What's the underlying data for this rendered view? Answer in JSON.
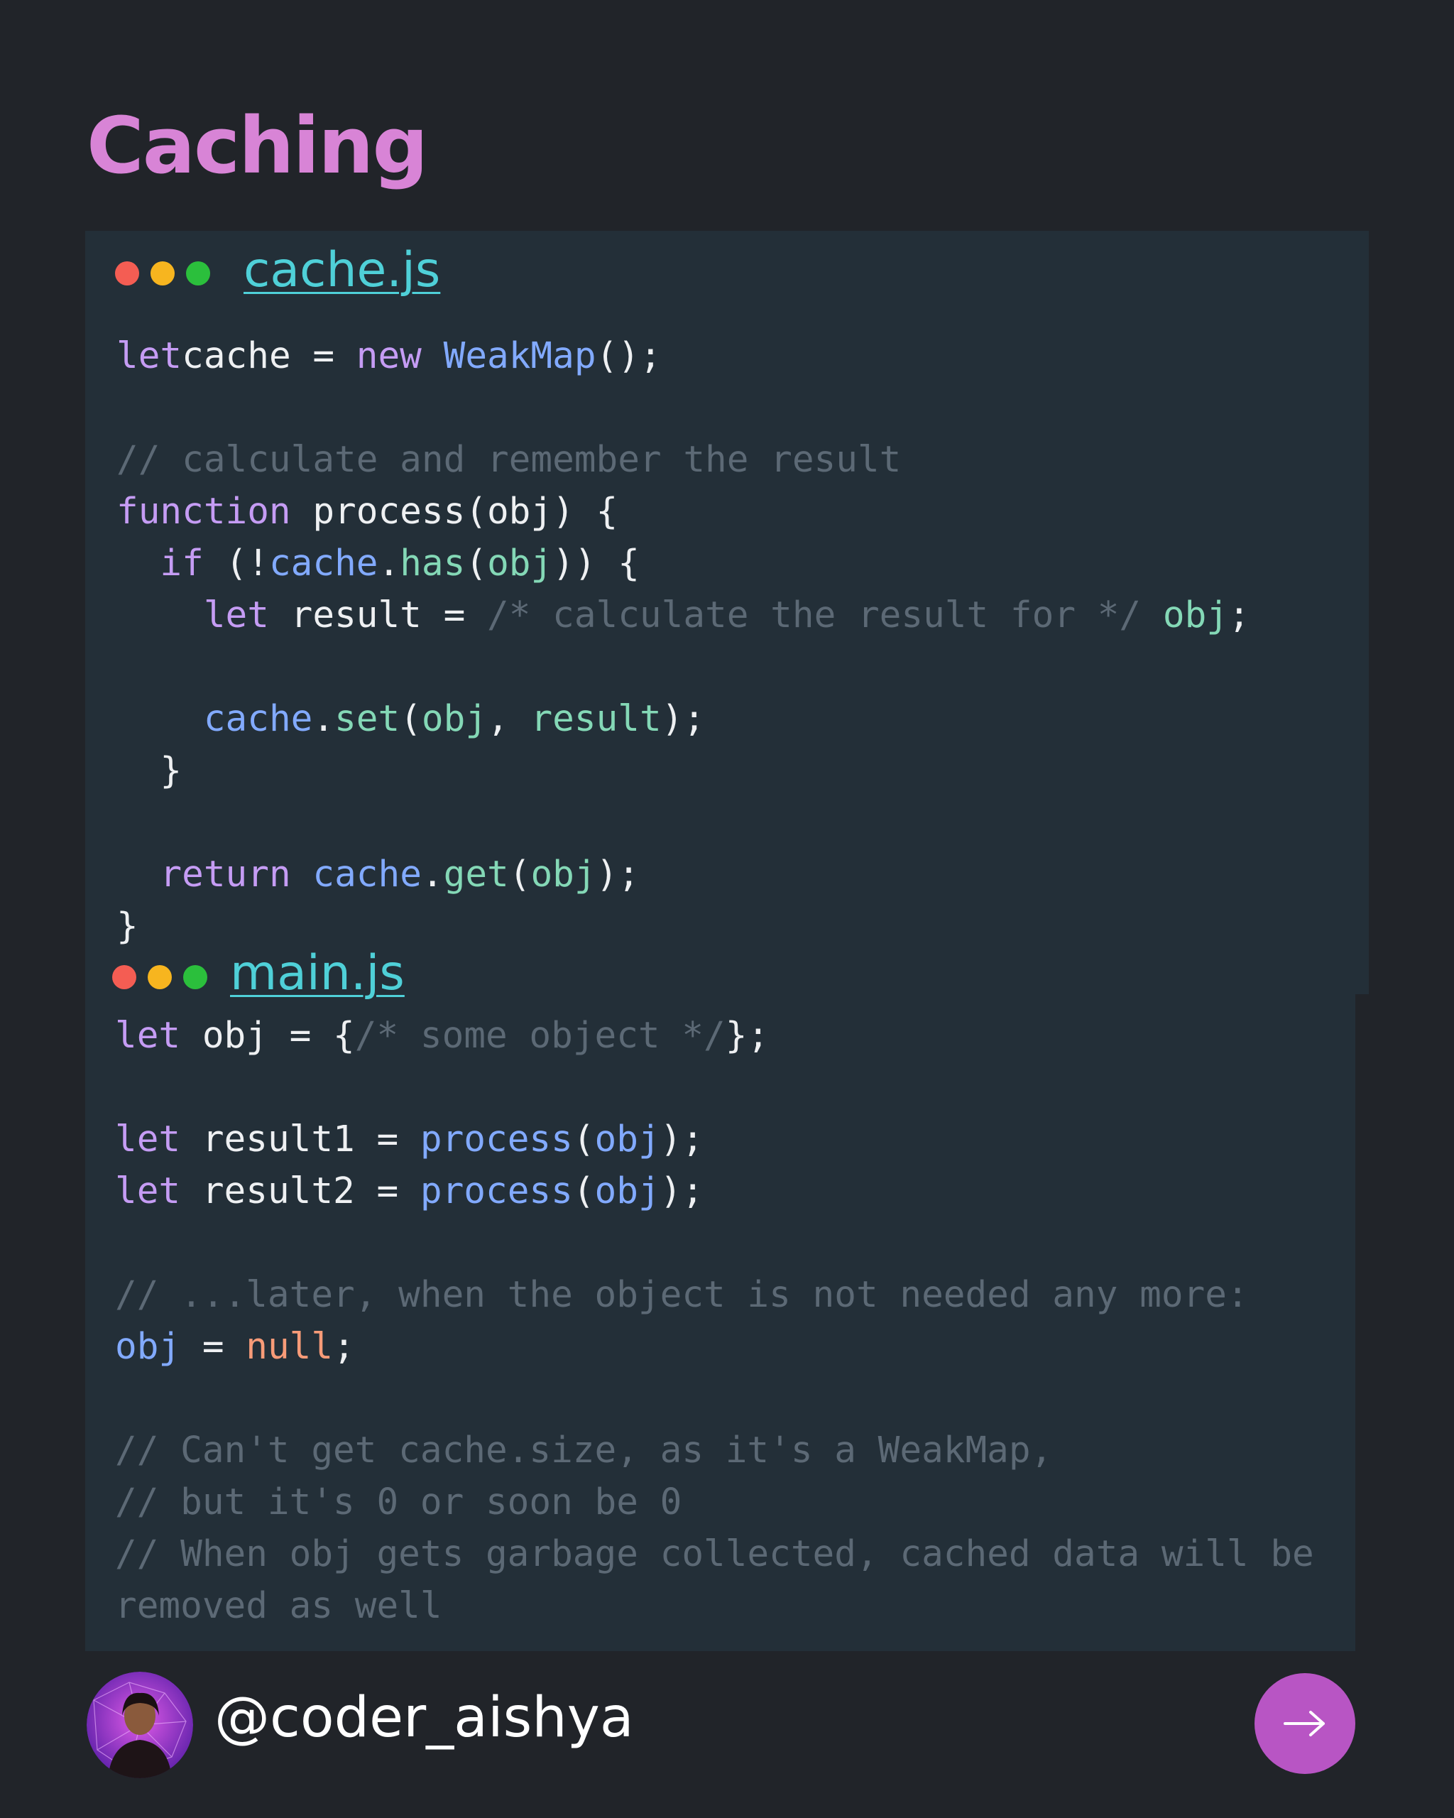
{
  "title": "Caching",
  "colors": {
    "background": "#212429",
    "title": "#d884d6",
    "panel": "#232f38",
    "filename": "#4fd0d8",
    "button": "#b855c4"
  },
  "file1": {
    "name": "cache.js",
    "lines": [
      [
        [
          "kw",
          "let"
        ],
        [
          "",
          "cache = "
        ],
        [
          "kw",
          "new"
        ],
        [
          "",
          " "
        ],
        [
          "fn",
          "WeakMap"
        ],
        [
          "",
          "();"
        ]
      ],
      [],
      [
        [
          "cm",
          "// calculate and remember the result"
        ]
      ],
      [
        [
          "kw",
          "function"
        ],
        [
          "",
          " process(obj) {"
        ]
      ],
      [
        [
          "",
          "  "
        ],
        [
          "kw",
          "if"
        ],
        [
          "",
          " (!"
        ],
        [
          "var",
          "cache"
        ],
        [
          "",
          "."
        ],
        [
          "prop",
          "has"
        ],
        [
          "",
          "("
        ],
        [
          "prop",
          "obj"
        ],
        [
          "",
          ")) {"
        ]
      ],
      [
        [
          "",
          "    "
        ],
        [
          "kw",
          "let"
        ],
        [
          "",
          " result = "
        ],
        [
          "cm",
          "/* calculate the result for */"
        ],
        [
          "",
          " "
        ],
        [
          "prop",
          "obj"
        ],
        [
          "",
          ";"
        ]
      ],
      [],
      [
        [
          "",
          "    "
        ],
        [
          "var",
          "cache"
        ],
        [
          "",
          "."
        ],
        [
          "prop",
          "set"
        ],
        [
          "",
          "("
        ],
        [
          "prop",
          "obj"
        ],
        [
          "",
          ", "
        ],
        [
          "prop",
          "result"
        ],
        [
          "",
          ");"
        ]
      ],
      [
        [
          "",
          "  }"
        ]
      ],
      [],
      [
        [
          "",
          "  "
        ],
        [
          "kw",
          "return"
        ],
        [
          "",
          " "
        ],
        [
          "var",
          "cache"
        ],
        [
          "",
          "."
        ],
        [
          "prop",
          "get"
        ],
        [
          "",
          "("
        ],
        [
          "prop",
          "obj"
        ],
        [
          "",
          ");"
        ]
      ],
      [
        [
          "",
          "}"
        ]
      ]
    ]
  },
  "file2": {
    "name": "main.js",
    "lines": [
      [
        [
          "kw",
          "let"
        ],
        [
          "",
          " obj = {"
        ],
        [
          "cm",
          "/* some object */"
        ],
        [
          "",
          "};"
        ]
      ],
      [],
      [
        [
          "kw",
          "let"
        ],
        [
          "",
          " result1 = "
        ],
        [
          "fn",
          "process"
        ],
        [
          "",
          "("
        ],
        [
          "var",
          "obj"
        ],
        [
          "",
          ");"
        ]
      ],
      [
        [
          "kw",
          "let"
        ],
        [
          "",
          " result2 = "
        ],
        [
          "fn",
          "process"
        ],
        [
          "",
          "("
        ],
        [
          "var",
          "obj"
        ],
        [
          "",
          ");"
        ]
      ],
      [],
      [
        [
          "cm",
          "// ...later, when the object is not needed any more:"
        ]
      ],
      [
        [
          "var",
          "obj"
        ],
        [
          "",
          " = "
        ],
        [
          "lit",
          "null"
        ],
        [
          "",
          ";"
        ]
      ],
      [],
      [
        [
          "cm",
          "// Can't get cache.size, as it's a WeakMap,"
        ]
      ],
      [
        [
          "cm",
          "// but it's 0 or soon be 0"
        ]
      ],
      [
        [
          "cm",
          "// When obj gets garbage collected, cached data will be"
        ]
      ],
      [
        [
          "cm",
          "removed as well"
        ]
      ]
    ]
  },
  "footer": {
    "handle": "@coder_aishya"
  }
}
